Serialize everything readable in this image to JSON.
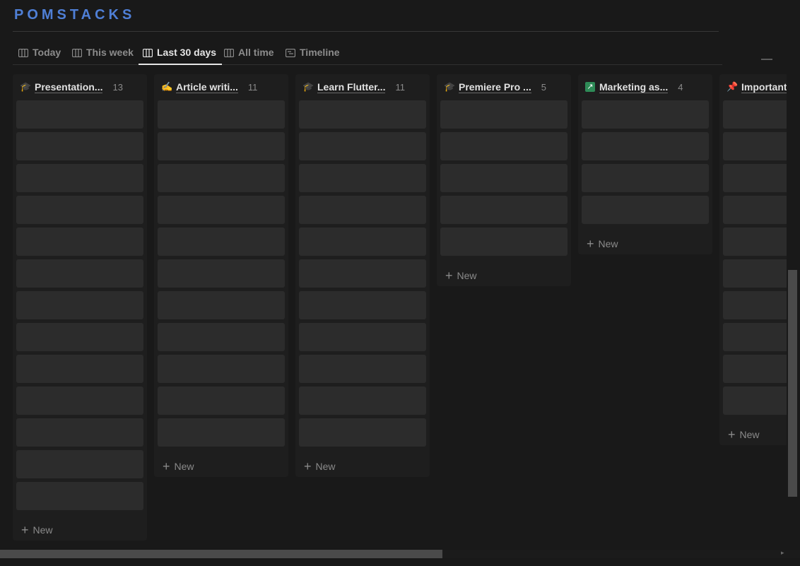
{
  "app": {
    "title": "POMSTACKS"
  },
  "tabs": [
    {
      "label": "Today",
      "active": false,
      "icon": "board-icon"
    },
    {
      "label": "This week",
      "active": false,
      "icon": "board-icon"
    },
    {
      "label": "Last 30 days",
      "active": true,
      "icon": "board-icon"
    },
    {
      "label": "All time",
      "active": false,
      "icon": "board-icon"
    },
    {
      "label": "Timeline",
      "active": false,
      "icon": "timeline-icon"
    }
  ],
  "columns": [
    {
      "emoji": "🎓",
      "icon": "graduation-cap-icon",
      "name": "Presentation...",
      "count": "13",
      "new_label": "New"
    },
    {
      "emoji": "✍️",
      "icon": "writing-hand-icon",
      "name": "Article writi...",
      "count": "11",
      "new_label": "New"
    },
    {
      "emoji": "🎓",
      "icon": "graduation-cap-icon",
      "name": "Learn Flutter...",
      "count": "11",
      "new_label": "New"
    },
    {
      "emoji": "🎓",
      "icon": "graduation-cap-icon",
      "name": "Premiere Pro ...",
      "count": "5",
      "new_label": "New"
    },
    {
      "emoji": "↗",
      "icon": "arrow-up-right-icon",
      "name": "Marketing as...",
      "count": "4",
      "new_label": "New"
    },
    {
      "emoji": "📌",
      "icon": "pushpin-icon",
      "name": "Important",
      "count": "",
      "new_label": "New",
      "card_count": 10
    }
  ],
  "colors": {
    "accent": "#4f7fd6",
    "background": "#191919",
    "card": "#2c2c2c"
  }
}
